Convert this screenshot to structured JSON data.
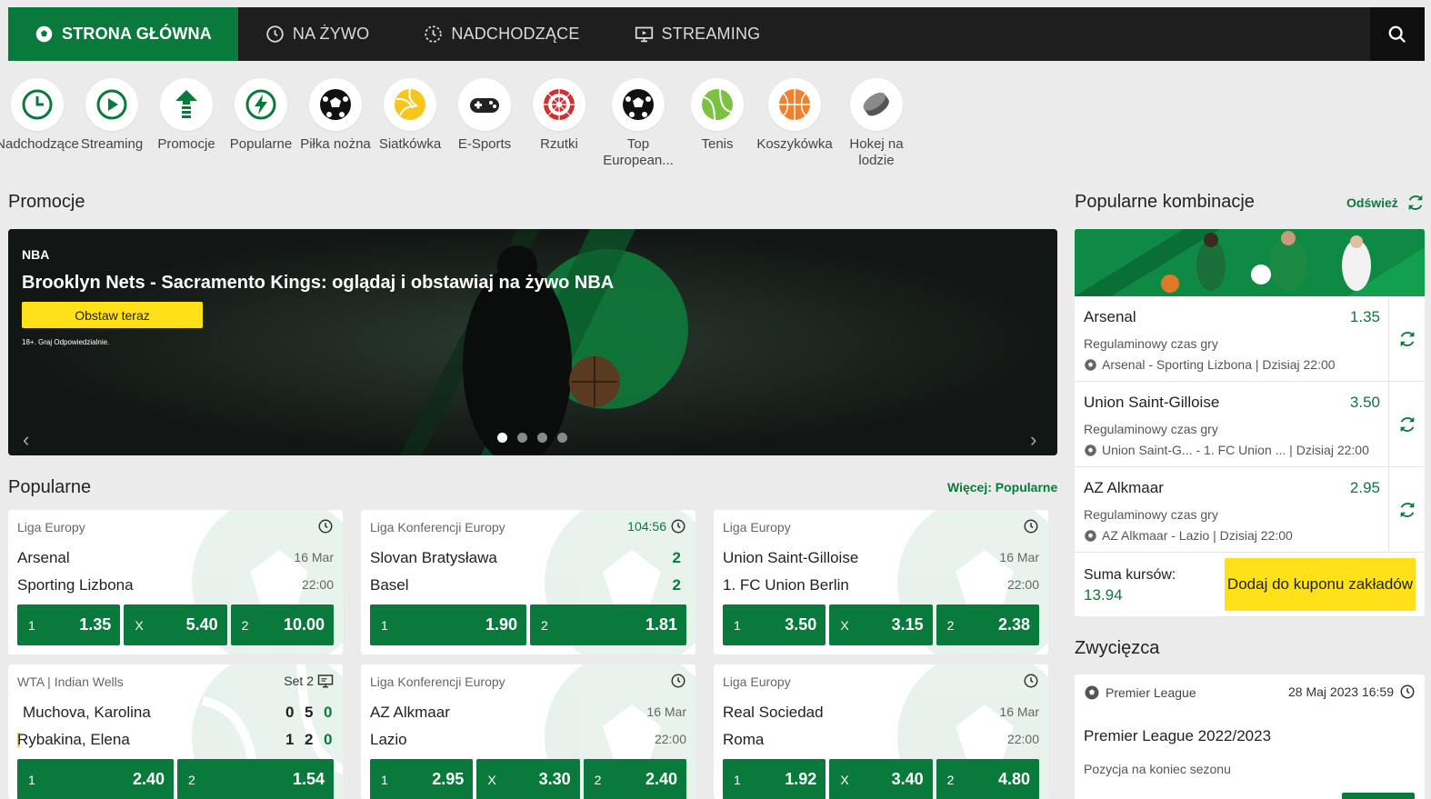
{
  "nav": {
    "items": [
      {
        "label": "STRONA GŁÓWNA",
        "icon": "soccer-ball-icon",
        "active": true
      },
      {
        "label": "NA ŻYWO",
        "icon": "live-clock-icon",
        "active": false
      },
      {
        "label": "NADCHODZĄCE",
        "icon": "upcoming-icon",
        "active": false
      },
      {
        "label": "STREAMING",
        "icon": "tv-screen-icon",
        "active": false
      }
    ],
    "search_icon": "search-icon"
  },
  "sports": [
    {
      "label": "Nadchodzące",
      "icon": "clock-icon"
    },
    {
      "label": "Streaming",
      "icon": "play-icon"
    },
    {
      "label": "Promocje",
      "icon": "up-arrow-icon"
    },
    {
      "label": "Popularne",
      "icon": "lightning-icon"
    },
    {
      "label": "Piłka nożna",
      "icon": "soccer-ball-icon"
    },
    {
      "label": "Siatkówka",
      "icon": "volleyball-icon"
    },
    {
      "label": "E-Sports",
      "icon": "gamepad-icon"
    },
    {
      "label": "Rzutki",
      "icon": "dartboard-icon"
    },
    {
      "label": "Top European...",
      "icon": "soccer-ball-icon"
    },
    {
      "label": "Tenis",
      "icon": "tennis-ball-icon"
    },
    {
      "label": "Koszykówka",
      "icon": "basketball-icon"
    },
    {
      "label": "Hokej na lodzie",
      "icon": "hockey-puck-icon"
    }
  ],
  "promos": {
    "title": "Promocje",
    "banner": {
      "tag": "NBA",
      "headline": "Brooklyn Nets - Sacramento Kings: oglądaj i obstawiaj na żywo NBA",
      "cta": "Obstaw teraz",
      "note": "18+. Graj Odpowiedzialnie.",
      "prev": "‹",
      "next": "›",
      "active_dot": 0
    }
  },
  "popular": {
    "title": "Popularne",
    "more_link": "Więcej: Popularne",
    "matches": [
      {
        "league": "Liga Europy",
        "meta": "",
        "home": "Arsenal",
        "away": "Sporting Lizbona",
        "date": "16 Mar",
        "time": "22:00",
        "odds": [
          {
            "label": "1",
            "value": "1.35"
          },
          {
            "label": "X",
            "value": "5.40"
          },
          {
            "label": "2",
            "value": "10.00"
          }
        ]
      },
      {
        "league": "Liga Konferencji Europy",
        "meta": "104:56",
        "home": "Slovan Bratysława",
        "away": "Basel",
        "home_score": "2",
        "away_score": "2",
        "odds": [
          {
            "label": "1",
            "value": "1.90"
          },
          {
            "label": "2",
            "value": "1.81"
          }
        ]
      },
      {
        "league": "Liga Europy",
        "meta": "",
        "home": "Union Saint-Gilloise",
        "away": "1. FC Union Berlin",
        "date": "16 Mar",
        "time": "22:00",
        "odds": [
          {
            "label": "1",
            "value": "3.50"
          },
          {
            "label": "X",
            "value": "3.15"
          },
          {
            "label": "2",
            "value": "2.38"
          }
        ]
      },
      {
        "league": "WTA | Indian Wells",
        "meta": "Set 2",
        "home": "Muchova, Karolina",
        "away": "Rybakina, Elena",
        "home_sets": [
          "0",
          "5",
          "0"
        ],
        "away_sets": [
          "1",
          "2",
          "0"
        ],
        "odds": [
          {
            "label": "1",
            "value": "2.40"
          },
          {
            "label": "2",
            "value": "1.54"
          }
        ]
      },
      {
        "league": "Liga Konferencji Europy",
        "meta": "",
        "home": "AZ Alkmaar",
        "away": "Lazio",
        "date": "16 Mar",
        "time": "22:00",
        "odds": [
          {
            "label": "1",
            "value": "2.95"
          },
          {
            "label": "X",
            "value": "3.30"
          },
          {
            "label": "2",
            "value": "2.40"
          }
        ]
      },
      {
        "league": "Liga Europy",
        "meta": "",
        "home": "Real Sociedad",
        "away": "Roma",
        "date": "16 Mar",
        "time": "22:00",
        "odds": [
          {
            "label": "1",
            "value": "1.92"
          },
          {
            "label": "X",
            "value": "3.40"
          },
          {
            "label": "2",
            "value": "4.80"
          }
        ]
      }
    ]
  },
  "combos": {
    "title": "Popularne kombinacje",
    "refresh_label": "Odśwież",
    "items": [
      {
        "selection": "Arsenal",
        "odd": "1.35",
        "type": "Regulaminowy czas gry",
        "match": "Arsenal - Sporting Lizbona | Dzisiaj 22:00"
      },
      {
        "selection": "Union Saint-Gilloise",
        "odd": "3.50",
        "type": "Regulaminowy czas gry",
        "match": "Union Saint-G...  - 1. FC Union ...  | Dzisiaj 22:00"
      },
      {
        "selection": "AZ Alkmaar",
        "odd": "2.95",
        "type": "Regulaminowy czas gry",
        "match": "AZ Alkmaar - Lazio | Dzisiaj 22:00"
      }
    ],
    "sum_label": "Suma kursów:",
    "sum_value": "13.94",
    "add_button": "Dodaj do kuponu zakładów"
  },
  "winner": {
    "title": "Zwycięzca",
    "league": "Premier League",
    "datetime": "28 Maj 2023 16:59",
    "event": "Premier League 2022/2023",
    "market": "Pozycja na koniec sezonu"
  },
  "colors": {
    "brand_green": "#0a7a3c",
    "accent_yellow": "#ffe11a",
    "nav_dark": "#1e1e1e"
  }
}
